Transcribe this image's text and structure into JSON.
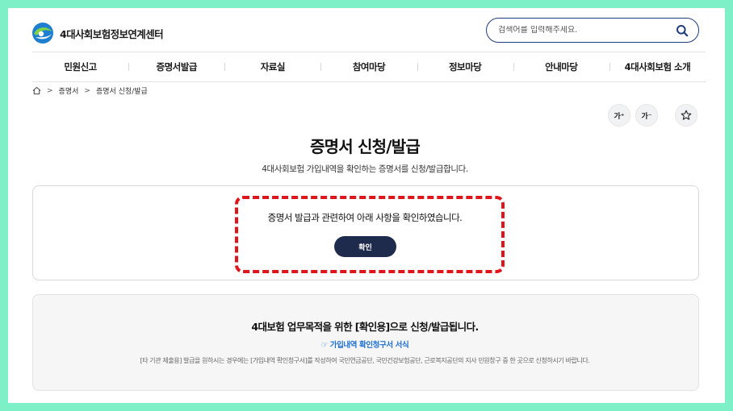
{
  "header": {
    "logo_text": "4대사회보험정보연계센터",
    "search_placeholder": "검색어를 입력해주세요."
  },
  "nav": {
    "items": [
      "민원신고",
      "증명서발급",
      "자료실",
      "참여마당",
      "정보마당",
      "안내마당",
      "4대사회보험 소개"
    ]
  },
  "breadcrumb": {
    "items": [
      "증명서",
      "증명서 신청/발급"
    ],
    "separator": ">"
  },
  "utils": {
    "font_up": "가⁺",
    "font_down": "가⁻"
  },
  "page": {
    "title": "증명서 신청/발급",
    "subtitle": "4대사회보험 가입내역을 확인하는 증명서를 신청/발급합니다."
  },
  "confirm": {
    "text": "증명서 발급과 관련하여 아래 사항을 확인하였습니다.",
    "button_label": "확인"
  },
  "info": {
    "title": "4대보험 업무목적을 위한 [확인용]으로 신청/발급됩니다.",
    "link_text": "☞ 가입내역 확인청구서 서식",
    "note": "[타 기관 제출용] 발급을 원하시는 경우에는 [가입내역 확인청구서]를 작성하여 국민연금공단, 국민건강보험공단, 근로복지공단의 지사 민원창구 중 한 곳으로 신청하시기 바랍니다."
  },
  "colors": {
    "accent": "#1f2b4d",
    "highlight": "#e0151b",
    "link": "#1e6fd0",
    "frame": "#7ef0c8"
  }
}
